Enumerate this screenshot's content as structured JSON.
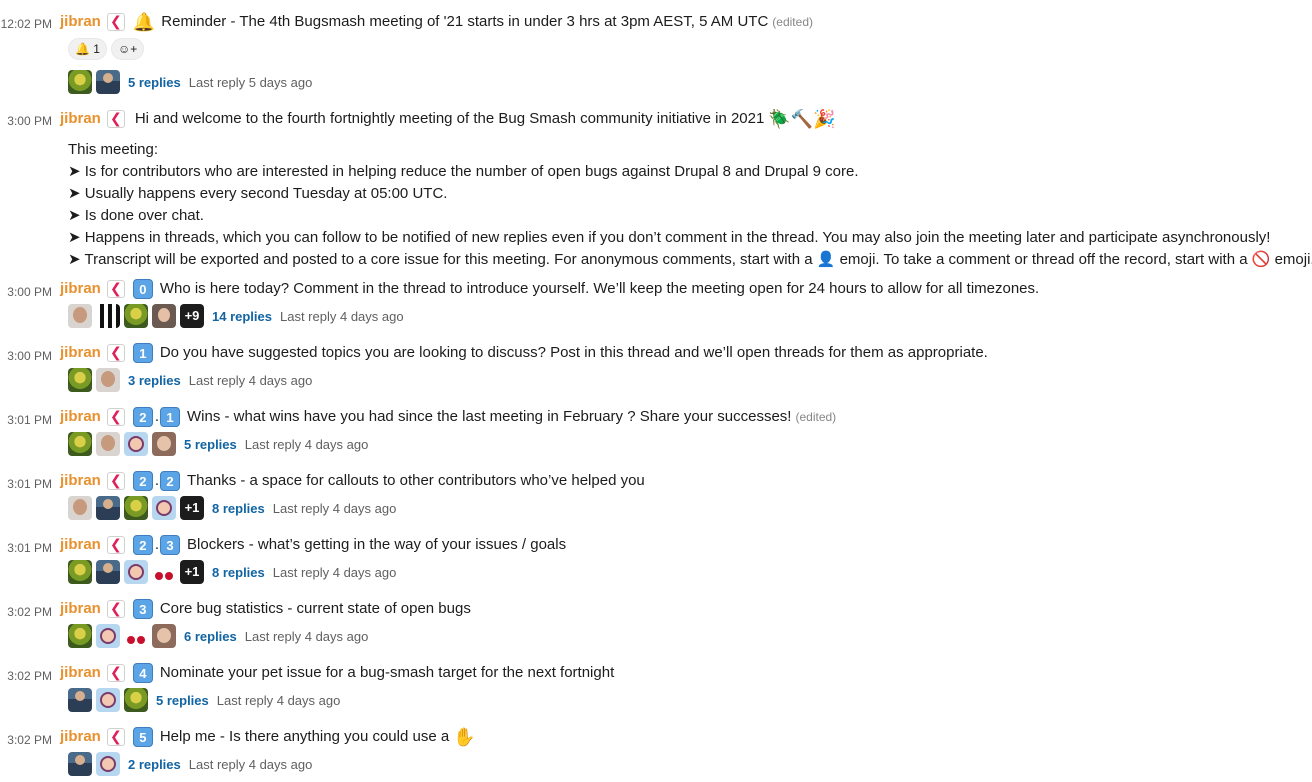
{
  "messages": [
    {
      "time": "12:02 PM",
      "author": "jibran",
      "badge": "❮",
      "prefix_emoji": "🔔",
      "text": "Reminder - The 4th Bugsmash meeting of '21 starts in under 3 hrs at 3pm AEST, 5 AM UTC",
      "edited": "(edited)",
      "reaction_count": "1",
      "replies": "5 replies",
      "last_reply": "Last reply 5 days ago"
    },
    {
      "time": "3:00 PM",
      "author": "jibran",
      "badge": "❮",
      "text": "Hi and welcome to the fourth fortnightly meeting of the Bug Smash community initiative in 2021",
      "suffix_emoji": "🪲🔨🎉",
      "body": [
        "This meeting:",
        "➤ Is for contributors who are interested in helping reduce the number of open bugs against Drupal 8 and Drupal 9 core.",
        "➤ Usually happens every second Tuesday at 05:00 UTC.",
        "➤ Is done over chat.",
        "➤ Happens in threads, which you can follow to be notified of new replies even if you don’t comment in the thread. You may also join the meeting later and participate asynchronously!",
        "➤ Transcript will be exported and posted to a core issue for this meeting. For anonymous comments, start with a 👤 emoji. To take a comment or thread off the record, start with a 🚫 emoji."
      ]
    },
    {
      "time": "3:00 PM",
      "author": "jibran",
      "badge": "❮",
      "keycaps": [
        "0"
      ],
      "text": "Who is here today? Comment in the thread to introduce yourself. We’ll keep the meeting open for 24 hours to allow for all timezones.",
      "more": "+9",
      "replies": "14 replies",
      "last_reply": "Last reply 4 days ago"
    },
    {
      "time": "3:00 PM",
      "author": "jibran",
      "badge": "❮",
      "keycaps": [
        "1"
      ],
      "text": "Do you have suggested topics you are looking to discuss? Post in this thread and we’ll open threads for them as appropriate.",
      "replies": "3 replies",
      "last_reply": "Last reply 4 days ago"
    },
    {
      "time": "3:01 PM",
      "author": "jibran",
      "badge": "❮",
      "keycaps": [
        "2",
        "1"
      ],
      "text": "Wins - what wins have you had since the last meeting in February ? Share your successes!",
      "edited": "(edited)",
      "replies": "5 replies",
      "last_reply": "Last reply 4 days ago"
    },
    {
      "time": "3:01 PM",
      "author": "jibran",
      "badge": "❮",
      "keycaps": [
        "2",
        "2"
      ],
      "text": "Thanks - a space for callouts to other contributors who’ve helped you",
      "more": "+1",
      "replies": "8 replies",
      "last_reply": "Last reply 4 days ago"
    },
    {
      "time": "3:01 PM",
      "author": "jibran",
      "badge": "❮",
      "keycaps": [
        "2",
        "3"
      ],
      "text": "Blockers - what’s getting in the way of your issues / goals",
      "more": "+1",
      "replies": "8 replies",
      "last_reply": "Last reply 4 days ago"
    },
    {
      "time": "3:02 PM",
      "author": "jibran",
      "badge": "❮",
      "keycaps": [
        "3"
      ],
      "text": "Core bug statistics - current state of open bugs",
      "replies": "6 replies",
      "last_reply": "Last reply 4 days ago"
    },
    {
      "time": "3:02 PM",
      "author": "jibran",
      "badge": "❮",
      "keycaps": [
        "4"
      ],
      "text": "Nominate your pet issue for a bug-smash target for the next fortnight",
      "replies": "5 replies",
      "last_reply": "Last reply 4 days ago"
    },
    {
      "time": "3:02 PM",
      "author": "jibran",
      "badge": "❮",
      "keycaps": [
        "5"
      ],
      "text": "Help me - Is there anything you could use a",
      "suffix_emoji": "✋",
      "replies": "2 replies",
      "last_reply": "Last reply 4 days ago"
    }
  ]
}
